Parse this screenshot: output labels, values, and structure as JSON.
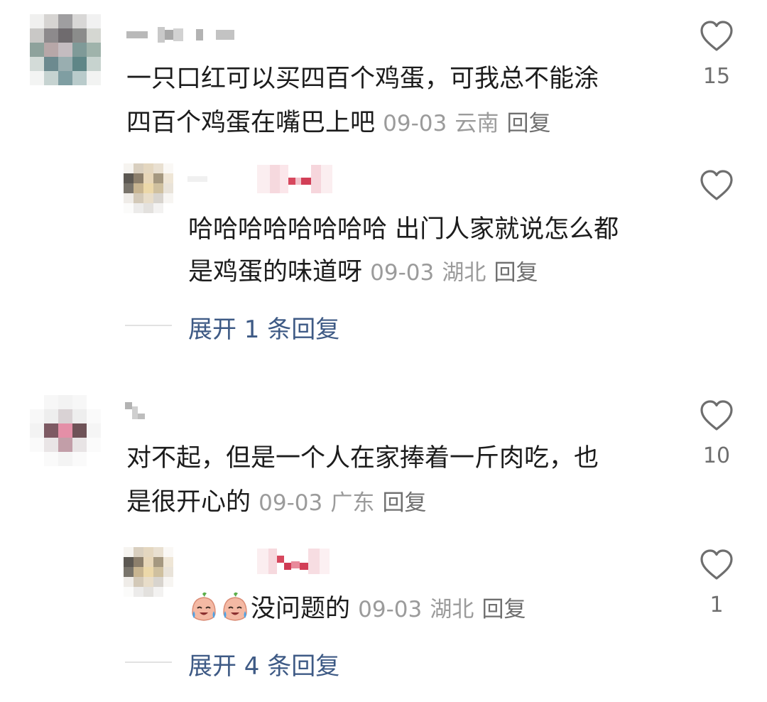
{
  "comments": [
    {
      "line1": "一只口红可以买四百个鸡蛋，可我总不能涂",
      "line2_text": "四百个鸡蛋在嘴巴上吧",
      "date": "09-03",
      "location": "云南",
      "reply_label": "回复",
      "likes": "15",
      "replies": [
        {
          "line1": "哈哈哈哈哈哈哈哈 出门人家就说怎么都",
          "line2_text": "是鸡蛋的味道呀",
          "date": "09-03",
          "location": "湖北",
          "reply_label": "回复",
          "likes": ""
        }
      ],
      "expand_label": "展开 1 条回复"
    },
    {
      "line1": "对不起，但是一个人在家捧着一斤肉吃，也",
      "line2_text": "是很开心的",
      "date": "09-03",
      "location": "广东",
      "reply_label": "回复",
      "likes": "10",
      "replies": [
        {
          "line1_text": "没问题的",
          "emoji": "crying-face-emoji",
          "date": "09-03",
          "location": "湖北",
          "reply_label": "回复",
          "likes": "1"
        }
      ],
      "expand_label": "展开 4 条回复"
    }
  ],
  "icons": {
    "like": "heart-outline-icon"
  },
  "colors": {
    "text": "#1c1c1c",
    "meta": "#9b9b9b",
    "link": "#3e5a85",
    "heart": "#6e6e6e"
  }
}
